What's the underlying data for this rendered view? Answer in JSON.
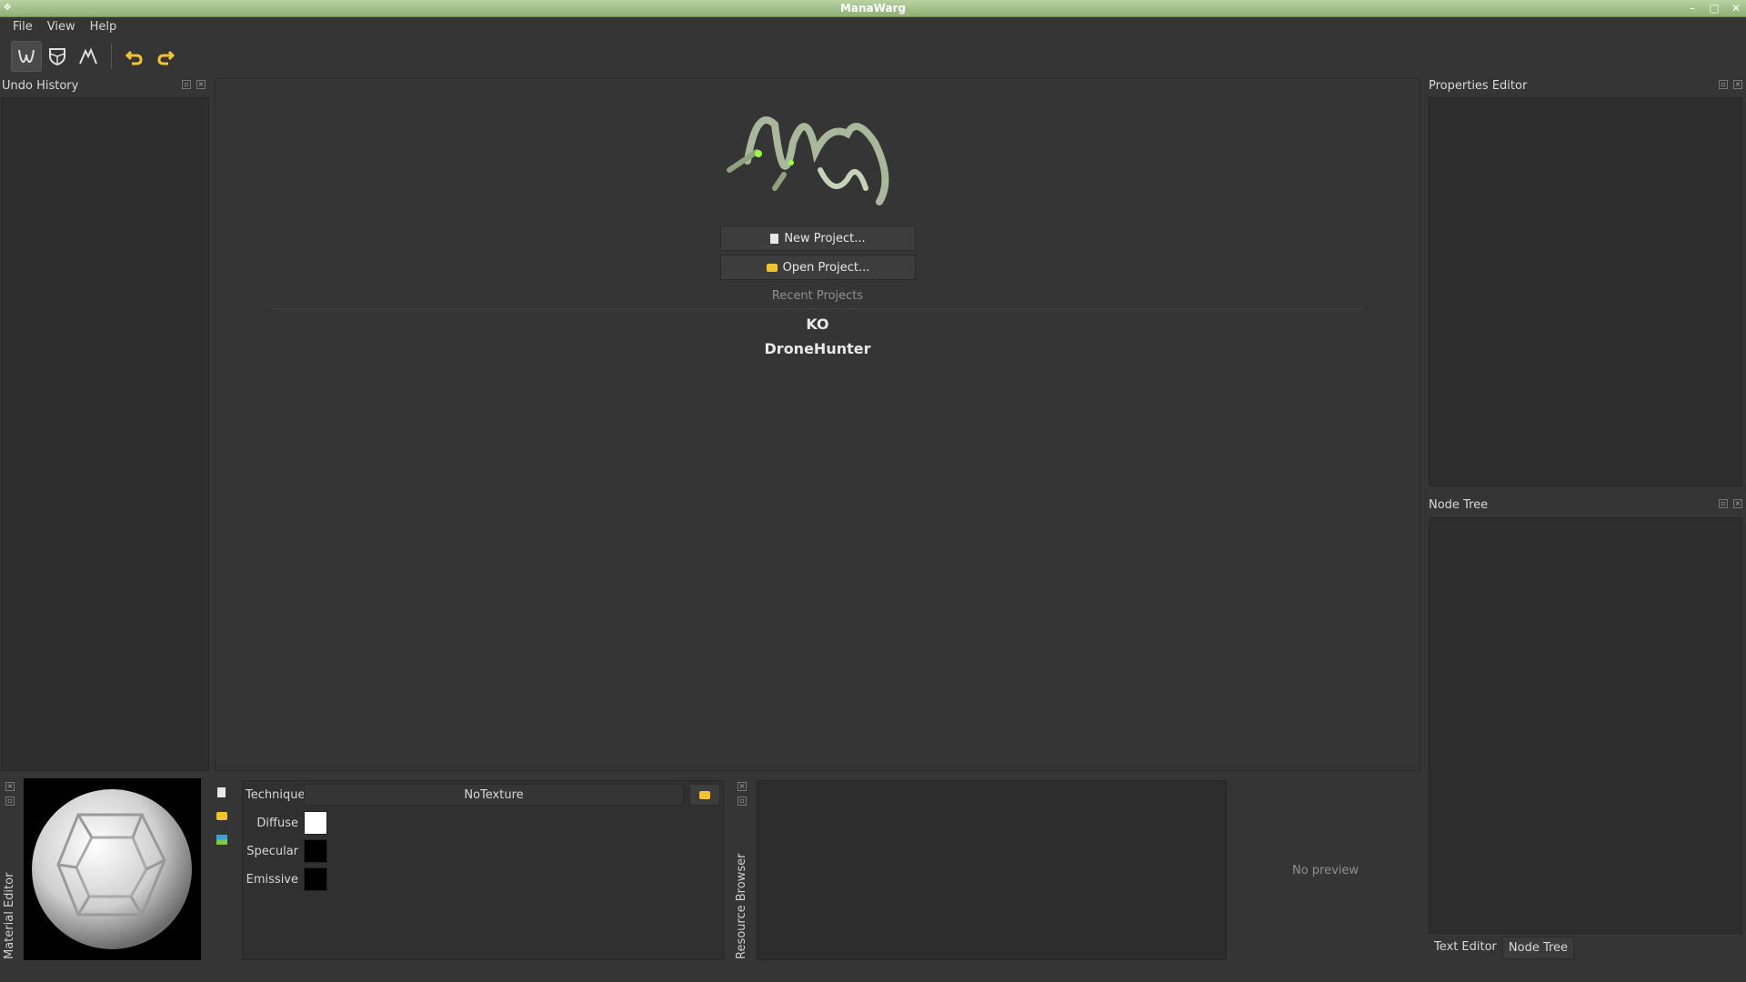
{
  "window": {
    "title": "ManaWarg"
  },
  "menu": {
    "items": [
      "File",
      "View",
      "Help"
    ]
  },
  "toolbar": {
    "icons": [
      "mode-w-icon",
      "shield-icon",
      "mountain-icon",
      "undo-icon",
      "redo-icon"
    ]
  },
  "docks": {
    "undo_history": {
      "title": "Undo History"
    },
    "properties_editor": {
      "title": "Properties Editor"
    },
    "node_tree": {
      "title": "Node Tree"
    },
    "material_editor": {
      "title": "Material Editor"
    },
    "resource_browser": {
      "title": "Resource Browser"
    }
  },
  "welcome": {
    "logo_text": "ManaWarg",
    "new_project_label": "New Project...",
    "open_project_label": "Open Project...",
    "recent_label": "Recent Projects",
    "recent_projects": [
      "KO",
      "DroneHunter"
    ]
  },
  "material": {
    "technique_label": "Technique",
    "technique_value": "NoTexture",
    "diffuse_label": "Diffuse",
    "specular_label": "Specular",
    "emissive_label": "Emissive",
    "colors": {
      "diffuse": "#ffffff",
      "specular": "#000000",
      "emissive": "#000000"
    }
  },
  "resource_preview": {
    "no_preview_label": "No preview"
  },
  "bottom_tabs": {
    "tabs": [
      "Text Editor",
      "Node Tree"
    ],
    "selected": "Node Tree"
  },
  "colors": {
    "accent": "#a7c78f",
    "background": "#353535",
    "panel": "#2d2d2d"
  }
}
